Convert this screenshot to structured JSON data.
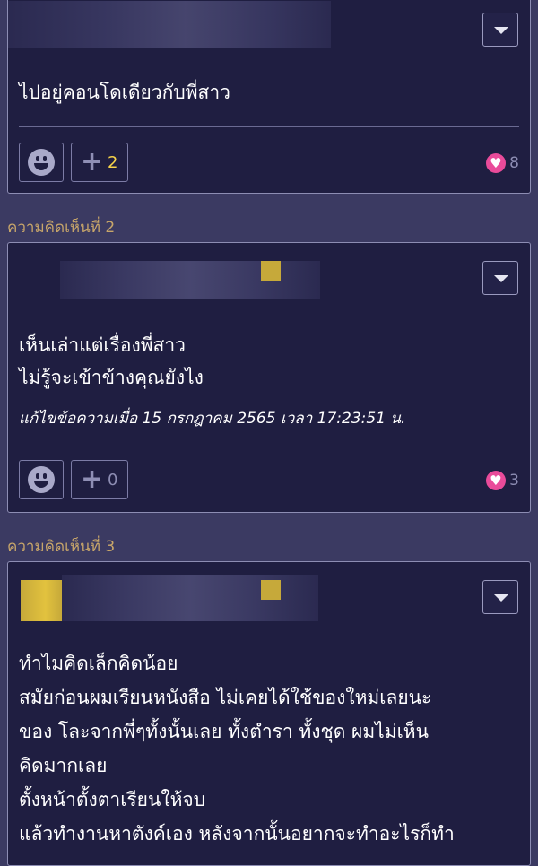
{
  "comments": [
    {
      "text_lines": [
        "ไปอยู่คอนโดเดียวกับพี่สาว"
      ],
      "plus_count": "2",
      "plus_color": "#f6d34a",
      "heart_count": "8"
    },
    {
      "label": "ความคิดเห็นที่ 2",
      "text_lines": [
        "เห็นเล่าแต่เรื่องพี่สาว",
        "ไม่รู้จะเข้าข้างคุณยังไง"
      ],
      "edit_note": "แก้ไขข้อความเมื่อ 15 กรกฎาคม 2565 เวลา 17:23:51 น.",
      "plus_count": "0",
      "plus_color": "#8d8db3",
      "heart_count": "3"
    },
    {
      "label": "ความคิดเห็นที่ 3",
      "text_lines": [
        "ทำไมคิดเล็กคิดน้อย",
        "สมัยก่อนผมเรียนหนังสือ ไม่เคยได้ใช้ของใหม่เลยนะ",
        "ของ โละจากพี่ๆทั้งนั้นเลย ทั้งตำรา ทั้งชุด ผมไม่เห็น",
        "คิดมากเลย",
        "ตั้งหน้าตั้งตาเรียนให้จบ",
        "แล้วทำงานหาตังค์เอง หลังจากนั้นอยากจะทำอะไรก็ทำ"
      ]
    }
  ],
  "colors": {
    "background": "#3b3a62",
    "card": "#1f1e41",
    "label": "#c8a66a",
    "heart": "#e94b9a"
  },
  "icons": {
    "dropdown": "chevron-down-icon",
    "emoji": "smiley-icon",
    "plus": "plus-icon",
    "heart": "heart-icon"
  }
}
